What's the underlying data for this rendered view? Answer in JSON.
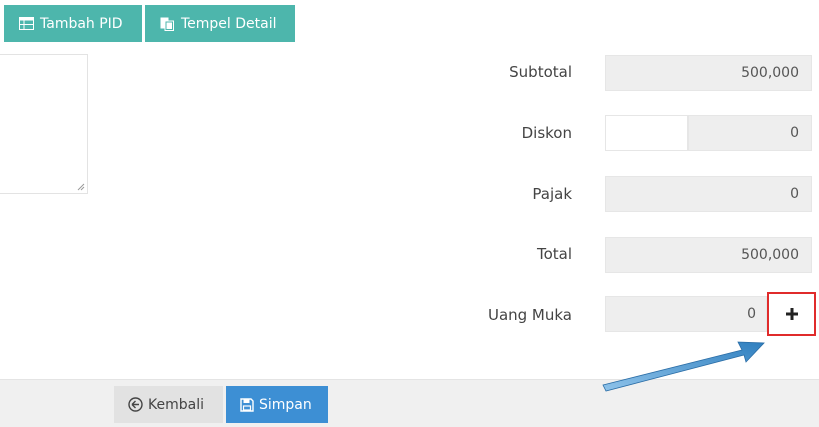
{
  "toolbar": {
    "add_pid_label": "Tambah PID",
    "paste_detail_label": "Tempel Detail"
  },
  "summary": {
    "subtotal": {
      "label": "Subtotal",
      "value": "500,000"
    },
    "diskon": {
      "label": "Diskon",
      "value": "0"
    },
    "pajak": {
      "label": "Pajak",
      "value": "0"
    },
    "total": {
      "label": "Total",
      "value": "500,000"
    },
    "uang_muka": {
      "label": "Uang Muka",
      "value": "0"
    }
  },
  "footer": {
    "back_label": "Kembali",
    "save_label": "Simpan"
  },
  "colors": {
    "teal": "#4db6ac",
    "blue": "#3d8fd4",
    "highlight_red": "#e02b2b",
    "annotation_arrow": "#2f7fbf"
  }
}
